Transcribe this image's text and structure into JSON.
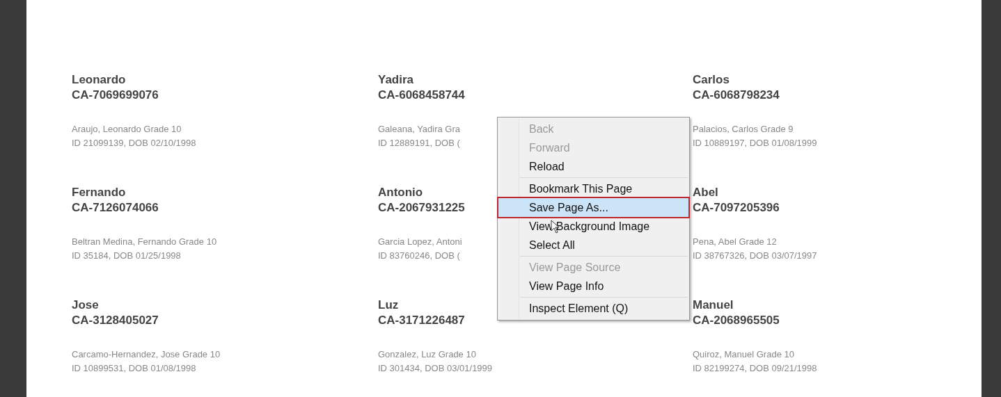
{
  "students": [
    {
      "name": "Leonardo",
      "student_id": "CA-7069699076",
      "details": "Araujo, Leonardo Grade 10",
      "dob_line": "ID 21099139, DOB 02/10/1998"
    },
    {
      "name": "Yadira",
      "student_id": "CA-6068458744",
      "details": "Galeana, Yadira Gra",
      "dob_line": "ID 12889191, DOB ("
    },
    {
      "name": "Carlos",
      "student_id": "CA-6068798234",
      "details": "Palacios, Carlos Grade 9",
      "dob_line": "ID 10889197, DOB 01/08/1999"
    },
    {
      "name": "Fernando",
      "student_id": "CA-7126074066",
      "details": "Beltran Medina, Fernando Grade 10",
      "dob_line": "ID 35184, DOB 01/25/1998"
    },
    {
      "name": "Antonio",
      "student_id": "CA-2067931225",
      "details": "Garcia Lopez, Antoni",
      "dob_line": "ID 83760246, DOB ("
    },
    {
      "name": "Abel",
      "student_id": "CA-7097205396",
      "details": "Pena, Abel Grade 12",
      "dob_line": "ID 38767326, DOB 03/07/1997"
    },
    {
      "name": "Jose",
      "student_id": "CA-3128405027",
      "details": "Carcamo-Hernandez, Jose Grade 10",
      "dob_line": "ID 10899531, DOB 01/08/1998"
    },
    {
      "name": "Luz",
      "student_id": "CA-3171226487",
      "details": "Gonzalez, Luz Grade 10",
      "dob_line": "ID 301434, DOB 03/01/1999"
    },
    {
      "name": "Manuel",
      "student_id": "CA-2068965505",
      "details": "Quiroz, Manuel Grade 10",
      "dob_line": "ID 82199274, DOB 09/21/1998"
    }
  ],
  "context_menu": {
    "items": [
      {
        "kind": "item",
        "label": "Back",
        "disabled": true,
        "selected": false
      },
      {
        "kind": "item",
        "label": "Forward",
        "disabled": true,
        "selected": false
      },
      {
        "kind": "item",
        "label": "Reload",
        "disabled": false,
        "selected": false
      },
      {
        "kind": "separator"
      },
      {
        "kind": "item",
        "label": "Bookmark This Page",
        "disabled": false,
        "selected": false
      },
      {
        "kind": "item",
        "label": "Save Page As...",
        "disabled": false,
        "selected": true
      },
      {
        "kind": "item",
        "label": "View Background Image",
        "disabled": false,
        "selected": false
      },
      {
        "kind": "item",
        "label": "Select All",
        "disabled": false,
        "selected": false
      },
      {
        "kind": "separator"
      },
      {
        "kind": "item",
        "label": "View Page Source",
        "disabled": true,
        "selected": false
      },
      {
        "kind": "item",
        "label": "View Page Info",
        "disabled": false,
        "selected": false
      },
      {
        "kind": "separator"
      },
      {
        "kind": "item",
        "label": "Inspect Element (Q)",
        "disabled": false,
        "selected": false
      }
    ]
  }
}
